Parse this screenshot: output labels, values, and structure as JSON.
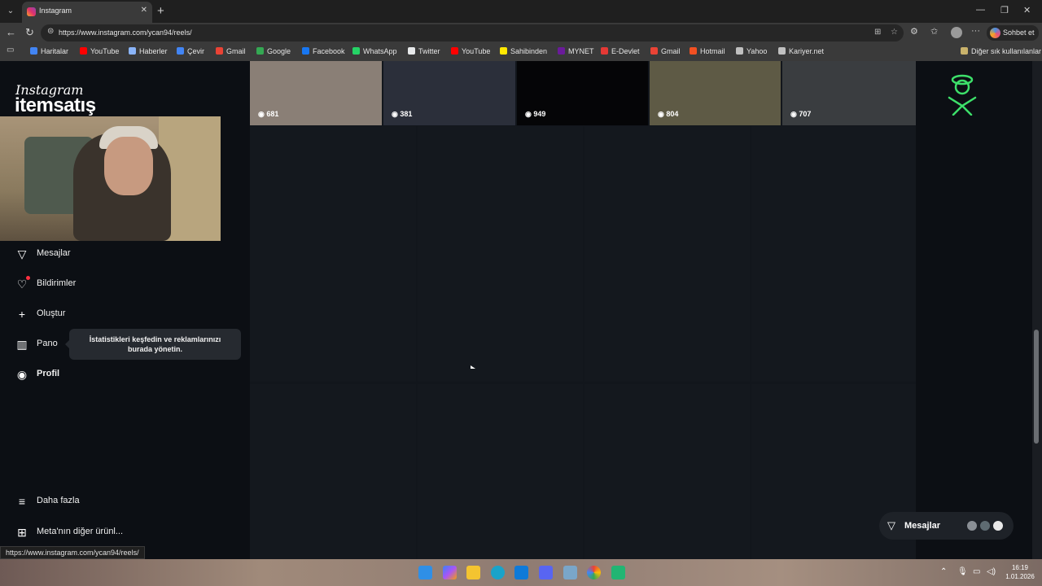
{
  "browser": {
    "tab_title": "Instagram",
    "url": "https://www.instagram.com/ycan94/reels/",
    "chat_button": "Sohbet et",
    "other_bookmarks": "Diğer sık kullanılanlar",
    "status_url": "https://www.instagram.com/ycan94/reels/"
  },
  "bookmarks": [
    {
      "label": "Haritalar",
      "color": "#4285f4"
    },
    {
      "label": "YouTube",
      "color": "#ff0000"
    },
    {
      "label": "Haberler",
      "color": "#8ab4f8"
    },
    {
      "label": "Çevir",
      "color": "#4285f4"
    },
    {
      "label": "Gmail",
      "color": "#ea4335"
    },
    {
      "label": "Google",
      "color": "#34a853"
    },
    {
      "label": "Facebook",
      "color": "#1877f2"
    },
    {
      "label": "WhatsApp",
      "color": "#25d366"
    },
    {
      "label": "Twitter",
      "color": "#e7e9ea"
    },
    {
      "label": "YouTube",
      "color": "#ff0000"
    },
    {
      "label": "Sahibinden",
      "color": "#ffe800"
    },
    {
      "label": "MYNET",
      "color": "#6a1b9a"
    },
    {
      "label": "E-Devlet",
      "color": "#e53935"
    },
    {
      "label": "Gmail",
      "color": "#ea4335"
    },
    {
      "label": "Hotmail",
      "color": "#f25022"
    },
    {
      "label": "Yahoo",
      "color": "#c0c0c0"
    },
    {
      "label": "Kariyer.net",
      "color": "#c0c0c0"
    }
  ],
  "brand": {
    "instagram": "Instagram",
    "overlay": "itemsatış"
  },
  "nav": {
    "messages": "Mesajlar",
    "notifications": "Bildirimler",
    "create": "Oluştur",
    "dashboard": "Pano",
    "profile": "Profil",
    "more": "Daha fazla",
    "meta": "Meta'nın diğer ürünl..."
  },
  "tooltip": "İstatistikleri keşfedin ve reklamlarınızı burada yönetin.",
  "reels": [
    {
      "views": "681",
      "bg": "#8a7f76"
    },
    {
      "views": "381",
      "bg": "#2b2f3a"
    },
    {
      "views": "949",
      "bg": "#050507"
    },
    {
      "views": "804",
      "bg": "#5e5a45"
    },
    {
      "views": "707",
      "bg": "#3a3d40"
    }
  ],
  "messages_pill": "Mesajlar",
  "clock": {
    "time": "16:19",
    "date": "1.01.2026"
  }
}
